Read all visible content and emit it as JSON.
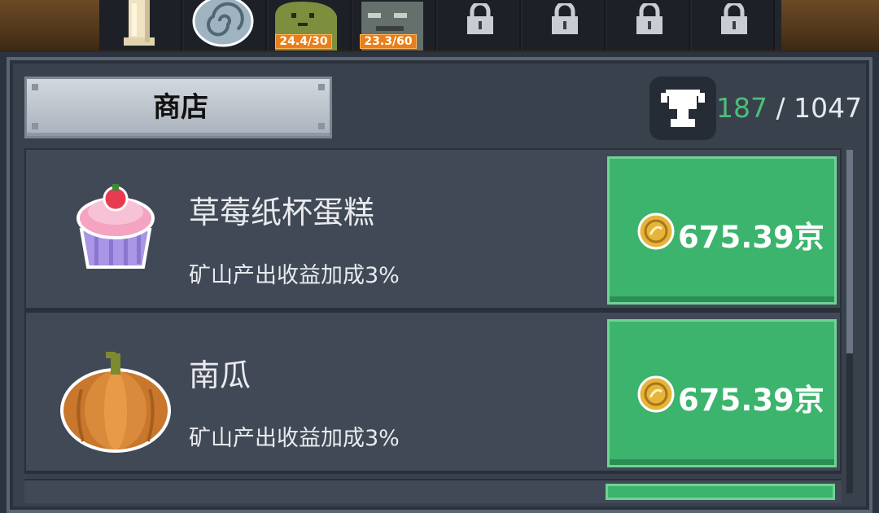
{
  "slots": [
    {
      "name": "candle",
      "level_text": ""
    },
    {
      "name": "swirl-orb",
      "level_text": ""
    },
    {
      "name": "green-slime",
      "level_text": "24.4/30"
    },
    {
      "name": "stone-golem",
      "level_text": "23.3/60"
    },
    {
      "name": "locked",
      "level_text": ""
    },
    {
      "name": "locked",
      "level_text": ""
    },
    {
      "name": "locked",
      "level_text": ""
    },
    {
      "name": "locked",
      "level_text": ""
    }
  ],
  "header": {
    "title": "商店"
  },
  "trophy": {
    "current": "187",
    "separator": " / ",
    "total": "1047",
    "icon": "trophy-icon"
  },
  "items": [
    {
      "name": "草莓纸杯蛋糕",
      "desc": "矿山产出收益加成3%",
      "price": "675.39京",
      "icon": "strawberry-cupcake-icon"
    },
    {
      "name": "南瓜",
      "desc": "矿山产出收益加成3%",
      "price": "675.39京",
      "icon": "pumpkin-icon"
    }
  ],
  "colors": {
    "buy_green": "#3cb46d",
    "trophy_green": "#4dbd78",
    "level_orange": "#e87f1c"
  }
}
